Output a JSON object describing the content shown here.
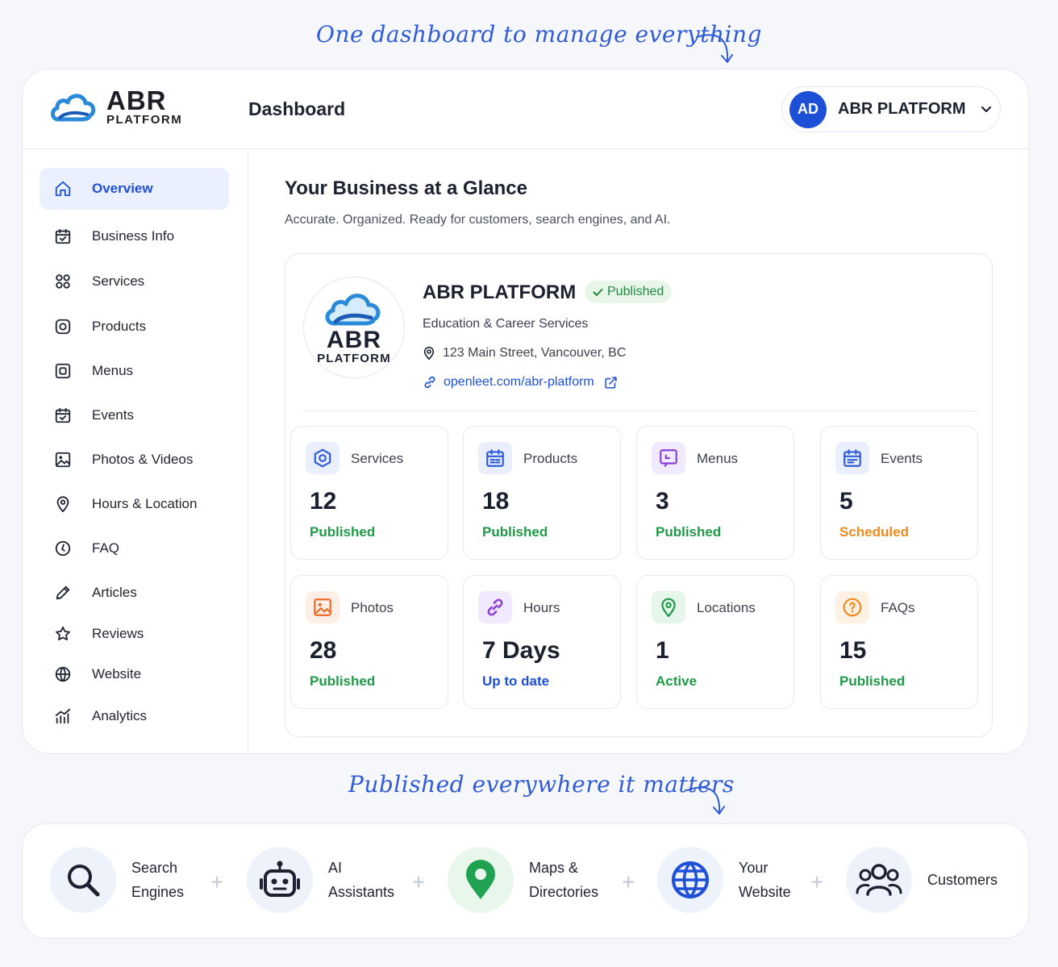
{
  "taglines": {
    "top": "One dashboard to manage everything",
    "bottom": "Published everywhere it matters"
  },
  "brand": {
    "name": "ABR",
    "sub": "PLATFORM"
  },
  "header": {
    "page_title": "Dashboard",
    "account": {
      "initials": "AD",
      "name": "ABR PLATFORM"
    }
  },
  "sidebar": {
    "items": [
      {
        "label": "Overview",
        "icon": "home-icon",
        "active": true
      },
      {
        "label": "Business Info",
        "icon": "calendar-check-icon"
      },
      {
        "label": "Services",
        "icon": "grid-circles-icon"
      },
      {
        "label": "Products",
        "icon": "target-square-icon"
      },
      {
        "label": "Menus",
        "icon": "menu-square-icon"
      },
      {
        "label": "Events",
        "icon": "calendar-icon"
      },
      {
        "label": "Photos & Videos",
        "icon": "image-icon"
      },
      {
        "label": "Hours & Location",
        "icon": "map-pin-icon"
      },
      {
        "label": "FAQ",
        "icon": "clock-icon"
      },
      {
        "label": "Articles",
        "icon": "pencil-icon"
      },
      {
        "label": "Reviews",
        "icon": "star-icon"
      },
      {
        "label": "Website",
        "icon": "globe-icon"
      },
      {
        "label": "Analytics",
        "icon": "analytics-icon"
      }
    ]
  },
  "main": {
    "title": "Your Business at a Glance",
    "subtitle": "Accurate. Organized. Ready for customers, search engines, and AI.",
    "business": {
      "name": "ABR PLATFORM",
      "status": "Published",
      "category": "Education & Career Services",
      "address": "123 Main Street, Vancouver, BC",
      "url": "openleet.com/abr-platform"
    },
    "stats": [
      {
        "label": "Services",
        "value": "12",
        "status": "Published",
        "tone": "green",
        "icon": "hexagon-icon",
        "color": "#2f5bd8",
        "bg": "#e9effd"
      },
      {
        "label": "Products",
        "value": "18",
        "status": "Published",
        "tone": "green",
        "icon": "calendar-box-icon",
        "color": "#2f5bd8",
        "bg": "#e9effd"
      },
      {
        "label": "Menus",
        "value": "3",
        "status": "Published",
        "tone": "green",
        "icon": "menu-board-icon",
        "color": "#8a3fd8",
        "bg": "#f1e9fd"
      },
      {
        "label": "Events",
        "value": "5",
        "status": "Scheduled",
        "tone": "orange",
        "icon": "calendar-icon",
        "color": "#2f5bd8",
        "bg": "#e9effd"
      },
      {
        "label": "Photos",
        "value": "28",
        "status": "Published",
        "tone": "green",
        "icon": "photo-icon",
        "color": "#ef6a2a",
        "bg": "#fdeee6"
      },
      {
        "label": "Hours",
        "value": "7 Days",
        "status": "Up to date",
        "tone": "blue",
        "icon": "link-icon",
        "color": "#8a3fd8",
        "bg": "#f1e9fd"
      },
      {
        "label": "Locations",
        "value": "1",
        "status": "Active",
        "tone": "green",
        "icon": "location-icon",
        "color": "#1f9a47",
        "bg": "#e6f6ea"
      },
      {
        "label": "FAQs",
        "value": "15",
        "status": "Published",
        "tone": "green",
        "icon": "question-icon",
        "color": "#f08a1c",
        "bg": "#fdf1e3"
      }
    ]
  },
  "channels": [
    {
      "line1": "Search",
      "line2": "Engines",
      "icon": "search-icon"
    },
    {
      "line1": "AI",
      "line2": "Assistants",
      "icon": "robot-icon"
    },
    {
      "line1": "Maps &",
      "line2": "Directories",
      "icon": "map-pin-icon"
    },
    {
      "line1": "Your",
      "line2": "Website",
      "icon": "globe-icon"
    },
    {
      "line1": "Customers",
      "line2": "",
      "icon": "users-icon"
    }
  ],
  "colors": {
    "accent": "#1d4fd7",
    "green": "#1f9a47",
    "orange": "#f08a1c"
  }
}
